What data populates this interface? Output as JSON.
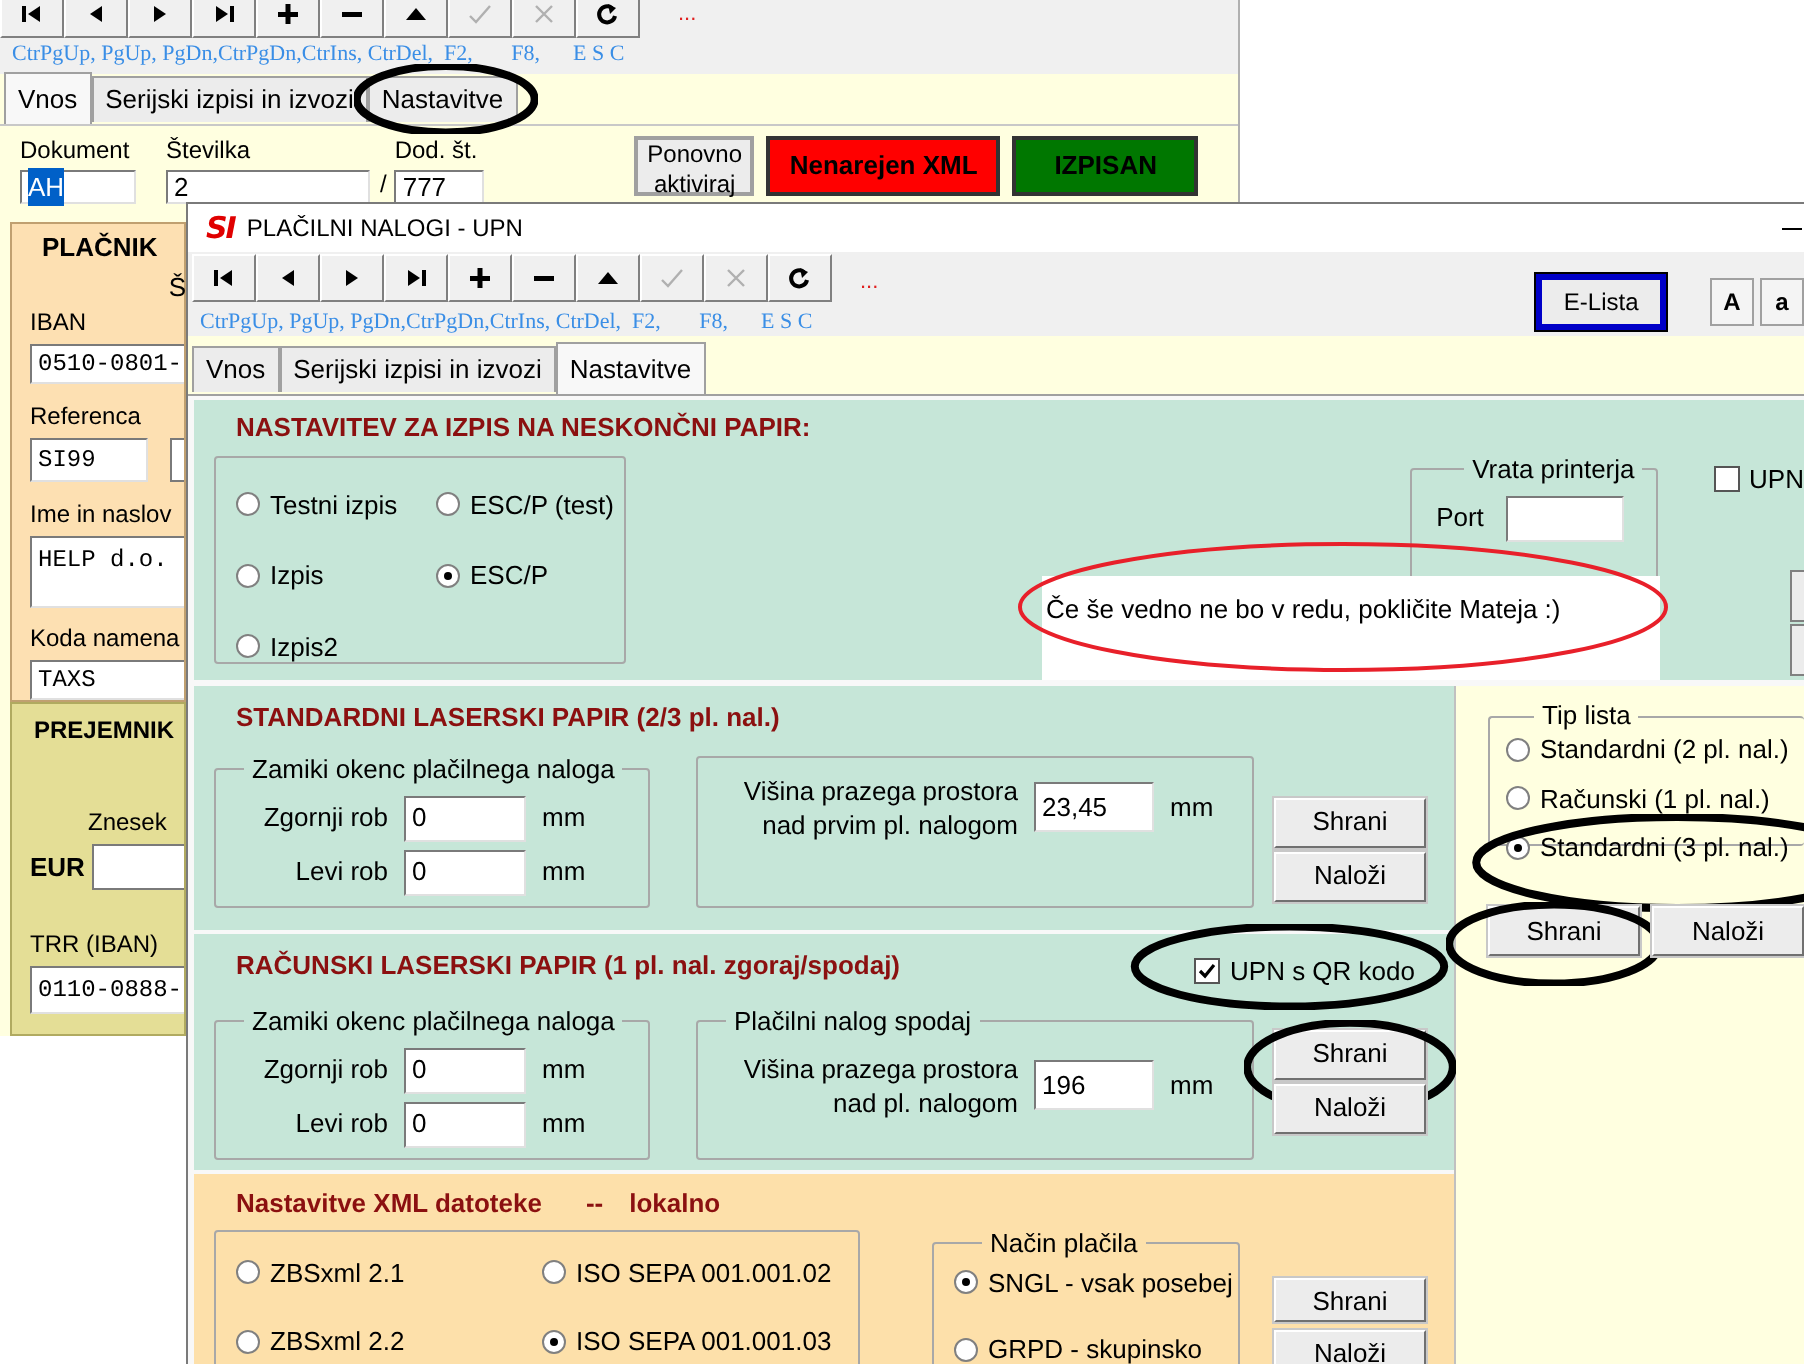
{
  "back_window": {
    "toolbar": [
      {
        "kind": "first",
        "disabled": false
      },
      {
        "kind": "prev",
        "disabled": false
      },
      {
        "kind": "next",
        "disabled": false
      },
      {
        "kind": "last",
        "disabled": false
      },
      {
        "kind": "add",
        "disabled": false
      },
      {
        "kind": "remove",
        "disabled": false
      },
      {
        "kind": "up",
        "disabled": false
      },
      {
        "kind": "confirm",
        "disabled": true
      },
      {
        "kind": "cancel",
        "disabled": true
      },
      {
        "kind": "refresh",
        "disabled": false
      }
    ],
    "more_mark": "...",
    "shortcuts": "CtrPgUp, PgUp, PgDn,CtrPgDn,CtrIns, CtrDel,  F2,       F8,      E S C",
    "tabs": [
      {
        "label": "Vnos",
        "selected": true
      },
      {
        "label": "Serijski izpisi in izvozi",
        "selected": false
      },
      {
        "label": "Nastavitve",
        "selected": false,
        "circled": true
      }
    ],
    "dokument": {
      "label": "Dokument",
      "value": "AH"
    },
    "stevilka": {
      "label": "Številka",
      "value": "2"
    },
    "separator": "/",
    "dod_st": {
      "label": "Dod. št.",
      "value": "777"
    },
    "buttons": [
      {
        "label": "Ponovno aktiviraj",
        "kind": "plain"
      },
      {
        "label": "Nenarejen XML",
        "kind": "red"
      },
      {
        "label": "IZPISAN",
        "kind": "green"
      }
    ],
    "placnik": {
      "title": "PLAČNIK",
      "fragment": "Š",
      "iban": {
        "label": "IBAN",
        "value": "0510-0801-"
      },
      "referenca": {
        "label": "Referenca",
        "value": "SI99"
      },
      "ime": {
        "label": "Ime in naslov",
        "value": "HELP d.o."
      },
      "koda": {
        "label": "Koda namena",
        "value": "TAXS"
      }
    },
    "prejemnik": {
      "title": "PREJEMNIK",
      "znesek_label": "Znesek",
      "currency": "EUR",
      "trr": {
        "label": "TRR (IBAN)",
        "value": "0110-0888-"
      }
    }
  },
  "front_window": {
    "logo": "SI",
    "title": "PLAČILNI NALOGI - UPN",
    "toolbar": [
      {
        "kind": "first",
        "disabled": false
      },
      {
        "kind": "prev",
        "disabled": false
      },
      {
        "kind": "next",
        "disabled": false
      },
      {
        "kind": "last",
        "disabled": false
      },
      {
        "kind": "add",
        "disabled": false
      },
      {
        "kind": "remove",
        "disabled": false
      },
      {
        "kind": "up",
        "disabled": false
      },
      {
        "kind": "confirm",
        "disabled": true
      },
      {
        "kind": "cancel",
        "disabled": true
      },
      {
        "kind": "refresh",
        "disabled": false
      }
    ],
    "more_mark": "...",
    "shortcuts": "CtrPgUp, PgUp, PgDn,CtrPgDn,CtrIns, CtrDel,  F2,       F8,      E S C",
    "elista": "E-Lista",
    "font_buttons": [
      "A",
      "a"
    ],
    "tabs": [
      {
        "label": "Vnos",
        "selected": false
      },
      {
        "label": "Serijski izpisi in izvozi",
        "selected": false
      },
      {
        "label": "Nastavitve",
        "selected": true
      }
    ],
    "endless_paper": {
      "title": "NASTAVITEV ZA IZPIS NA NESKONČNI PAPIR:",
      "modes": [
        {
          "label": "Testni izpis",
          "selected": false
        },
        {
          "label": "ESC/P (test)",
          "selected": false
        },
        {
          "label": "Izpis",
          "selected": false
        },
        {
          "label": "ESC/P",
          "selected": true
        },
        {
          "label": "Izpis2",
          "selected": false
        }
      ],
      "port_group": {
        "title": "Vrata printerja",
        "label": "Port"
      },
      "upn_checkbox": {
        "label": "UPN",
        "checked": false
      },
      "note": {
        "text": "Če še vedno ne bo v redu, pokličite Mateja :)",
        "circled": true
      }
    },
    "standard_laser": {
      "title": "STANDARDNI LASERSKI PAPIR (2/3 pl. nal.)",
      "offsets": {
        "title": "Zamiki okenc plačilnega naloga",
        "rows": [
          {
            "label": "Zgornji rob",
            "value": "0",
            "unit": "mm"
          },
          {
            "label": "Levi rob",
            "value": "0",
            "unit": "mm"
          }
        ]
      },
      "space": {
        "label_lines": [
          "Višina prazega prostora",
          "nad prvim pl. nalogom"
        ],
        "value": "23,45",
        "unit": "mm"
      },
      "buttons": [
        {
          "label": "Shrani"
        },
        {
          "label": "Naloži"
        }
      ]
    },
    "invoice_laser": {
      "title": "RAČUNSKI LASERSKI PAPIR (1 pl. nal. zgoraj/spodaj)",
      "qr_checkbox": {
        "label": "UPN s QR kodo",
        "checked": true,
        "circled": true
      },
      "offsets": {
        "title": "Zamiki okenc plačilnega naloga",
        "rows": [
          {
            "label": "Zgornji rob",
            "value": "0",
            "unit": "mm"
          },
          {
            "label": "Levi rob",
            "value": "0",
            "unit": "mm"
          }
        ]
      },
      "space": {
        "title": "Plačilni nalog spodaj",
        "label_lines": [
          "Višina prazega prostora",
          "nad pl. nalogom"
        ],
        "value": "196",
        "unit": "mm"
      },
      "buttons": [
        {
          "label": "Shrani",
          "circled": true
        },
        {
          "label": "Naloži"
        }
      ]
    },
    "sheet_type": {
      "title": "Tip lista",
      "options": [
        {
          "label": "Standardni (2 pl. nal.)",
          "selected": false
        },
        {
          "label": "Računski (1 pl. nal.)",
          "selected": false
        },
        {
          "label": "Standardni (3 pl. nal.)",
          "selected": true,
          "circled": true
        }
      ],
      "buttons": [
        {
          "label": "Shrani",
          "circled": true
        },
        {
          "label": "Naloži"
        }
      ]
    },
    "xml": {
      "title": "Nastavitve XML datoteke",
      "separator": "--",
      "location": "lokalno",
      "formats": [
        {
          "label": "ZBSxml 2.1",
          "selected": false
        },
        {
          "label": "ISO SEPA 001.001.02",
          "selected": false
        },
        {
          "label": "ZBSxml 2.2",
          "selected": false
        },
        {
          "label": "ISO SEPA 001.001.03",
          "selected": true
        }
      ],
      "payment": {
        "title": "Način plačila",
        "options": [
          {
            "label": "SNGL - vsak posebej",
            "selected": true
          },
          {
            "label": "GRPD - skupinsko",
            "selected": false
          }
        ]
      },
      "buttons": [
        {
          "label": "Shrani"
        },
        {
          "label": "Naloži"
        }
      ]
    }
  }
}
